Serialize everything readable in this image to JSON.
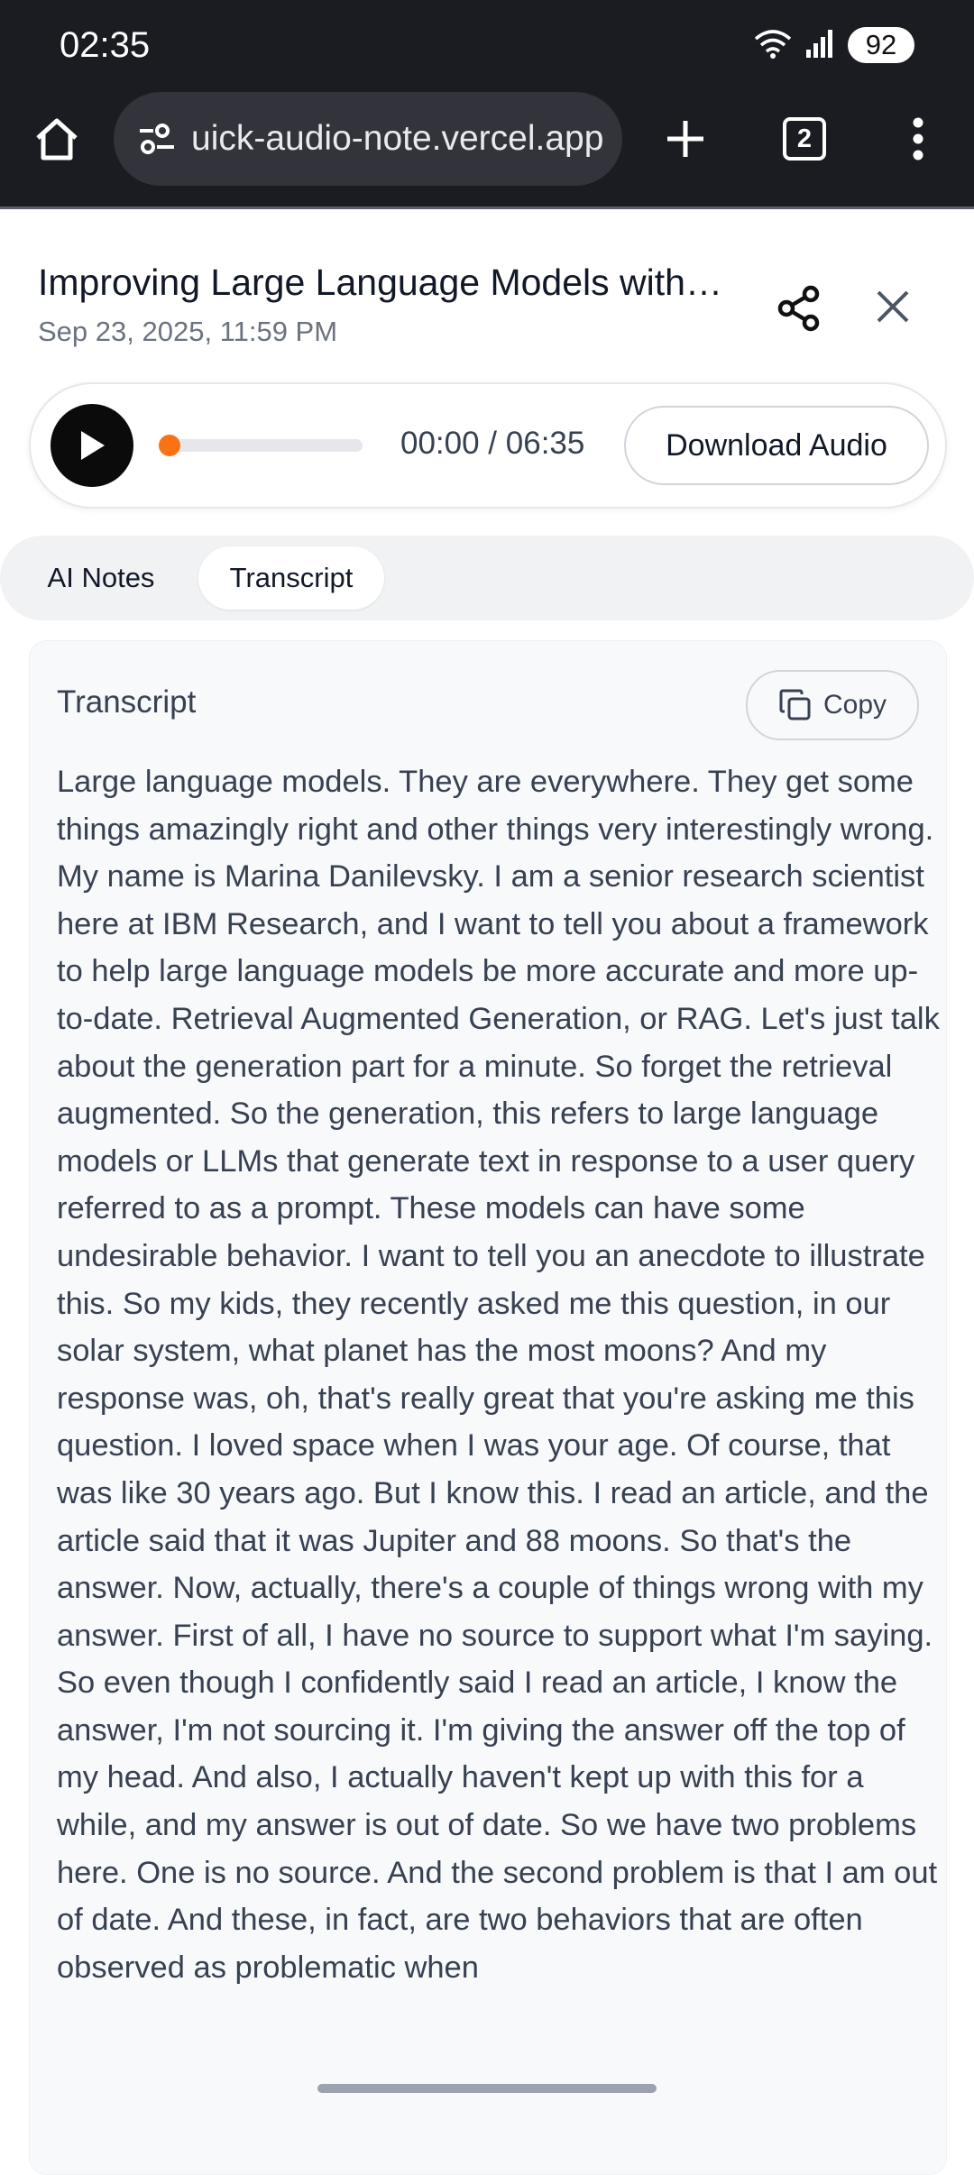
{
  "status_bar": {
    "time": "02:35",
    "battery": "92"
  },
  "browser": {
    "url": "uick-audio-note.vercel.app",
    "tab_count": "2"
  },
  "note": {
    "title": "Improving Large Language Models with…",
    "date": "Sep 23, 2025, 11:59 PM"
  },
  "player": {
    "time_readout": "00:00 / 06:35",
    "progress_fraction": 0.0,
    "download_label": "Download Audio"
  },
  "tabs": [
    {
      "label": "AI Notes",
      "active": false
    },
    {
      "label": "Transcript",
      "active": true
    }
  ],
  "transcript": {
    "heading": "Transcript",
    "copy_label": "Copy",
    "text": "Large language models. They are everywhere. They get some things amazingly right and other things very interestingly wrong. My name is Marina Danilevsky. I am a senior research scientist here at IBM Research, and I want to tell you about a framework to help large language models be more accurate and more up-to-date. Retrieval Augmented Generation, or RAG. Let's just talk about the generation part for a minute. So forget the retrieval augmented. So the generation, this refers to large language models or LLMs that generate text in response to a user query referred to as a prompt. These models can have some undesirable behavior. I want to tell you an anecdote to illustrate this. So my kids, they recently asked me this question, in our solar system, what planet has the most moons? And my response was, oh, that's really great that you're asking me this question. I loved space when I was your age. Of course, that was like 30 years ago. But I know this. I read an article, and the article said that it was Jupiter and 88 moons. So that's the answer. Now, actually, there's a couple of things wrong with my answer. First of all, I have no source to support what I'm saying. So even though I confidently said I read an article, I know the answer, I'm not sourcing it. I'm giving the answer off the top of my head. And also, I actually haven't kept up with this for a while, and my answer is out of date. So we have two problems here. One is no source. And the second problem is that I am out of date. And these, in fact, are two behaviors that are often observed as problematic when"
  },
  "icons": {
    "home": "home-icon",
    "site_settings": "site-settings-icon",
    "new_tab": "plus-icon",
    "menu": "more-vertical-icon",
    "share": "share-icon",
    "close": "close-icon",
    "play": "play-icon",
    "copy": "copy-icon"
  },
  "colors": {
    "accent": "#f97316",
    "chrome": "#1b1c21",
    "card": "#f8f9fb"
  }
}
